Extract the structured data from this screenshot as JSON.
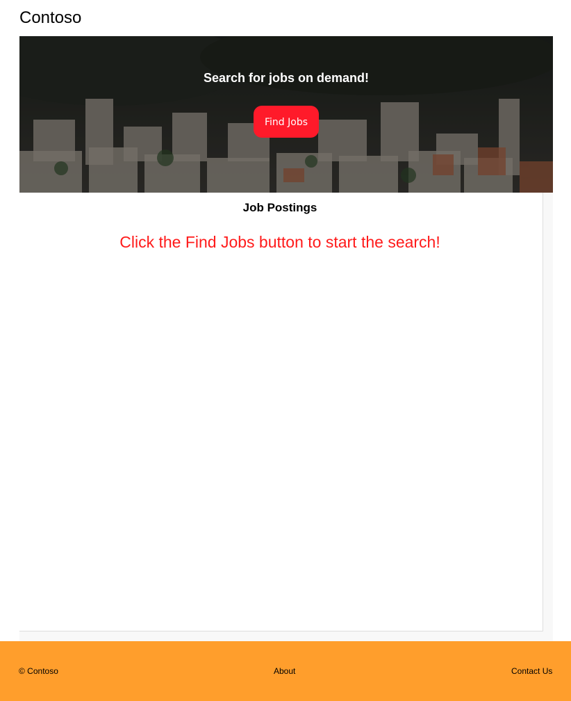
{
  "header": {
    "brand": "Contoso"
  },
  "hero": {
    "title": "Search for jobs on demand!",
    "button_label": "Find Jobs",
    "button_color": "#ff1a2a"
  },
  "main": {
    "title": "Job Postings",
    "prompt": "Click the Find Jobs button to start the search!",
    "prompt_color": "#ff1a1a"
  },
  "footer": {
    "copyright": "© Contoso",
    "about_label": "About",
    "contact_label": "Contact Us",
    "background": "#ff9e2c"
  }
}
